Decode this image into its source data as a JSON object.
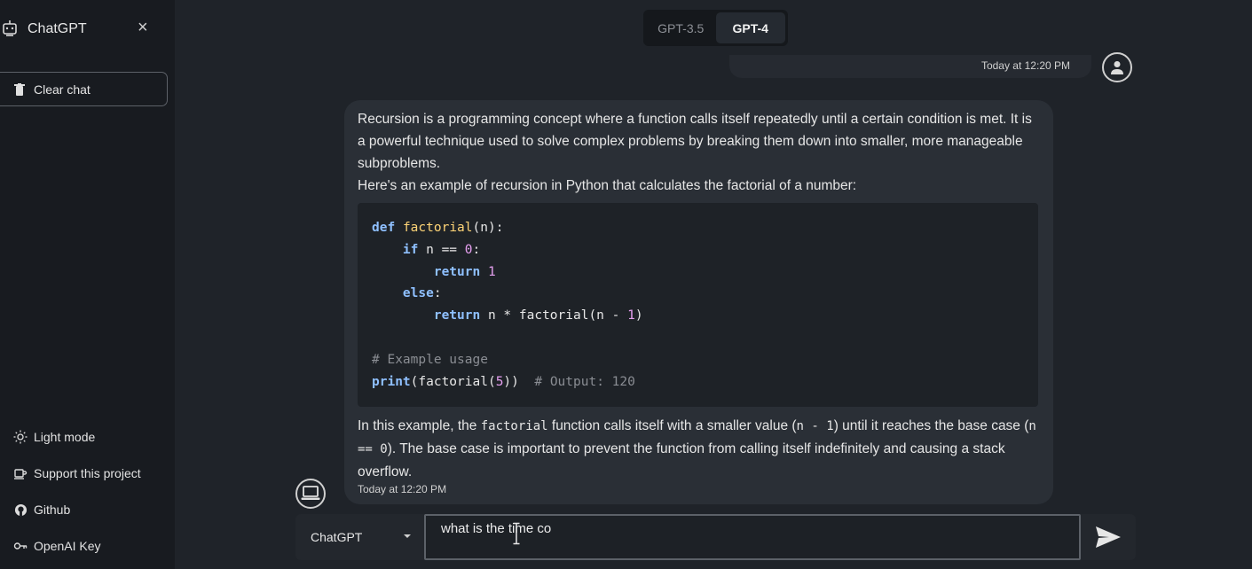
{
  "sidebar": {
    "title": "ChatGPT",
    "close_label": "×",
    "clear_label": "Clear chat",
    "items": [
      {
        "icon": "sun-icon",
        "label": "Light mode"
      },
      {
        "icon": "cup-icon",
        "label": "Support this project"
      },
      {
        "icon": "github-icon",
        "label": "Github"
      },
      {
        "icon": "key-icon",
        "label": "OpenAI Key"
      }
    ]
  },
  "model_toggle": {
    "options": [
      "GPT-3.5",
      "GPT-4"
    ],
    "selected": "GPT-4"
  },
  "user_message": {
    "timestamp": "Today at 12:20 PM"
  },
  "bot_message": {
    "intro_1": "Recursion is a programming concept where a function calls itself repeatedly until a certain condition is met. It is a powerful technique used to solve complex problems by breaking them down into smaller, more manageable subproblems.",
    "intro_2": "Here's an example of recursion in Python that calculates the factorial of a number:",
    "code": {
      "l1_kw": "def",
      "l1_fn": "factorial",
      "l1_rest": "(n):",
      "l2_kw": "if",
      "l2_rest": " n == ",
      "l2_num": "0",
      "l2_end": ":",
      "l3_kw": "return",
      "l3_num": "1",
      "l4_kw": "else",
      "l4_end": ":",
      "l5_kw": "return",
      "l5_rest": " n * factorial(n - ",
      "l5_num": "1",
      "l5_end": ")",
      "l7_comment": "# Example usage",
      "l8_kw": "print",
      "l8_rest": "(factorial(",
      "l8_num": "5",
      "l8_end": "))",
      "l8_comment": "# Output: 120"
    },
    "outro_a": "In this example, the ",
    "outro_code1": "factorial",
    "outro_b": " function calls itself with a smaller value (",
    "outro_code2": "n - 1",
    "outro_c": ") until it reaches the base case (",
    "outro_code3": "n == 0",
    "outro_d": "). The base case is important to prevent the function from calling itself indefinitely and causing a stack overflow.",
    "timestamp": "Today at 12:20 PM"
  },
  "composer": {
    "model_value": "ChatGPT",
    "input_value": "what is the time co"
  },
  "colors": {
    "background": "#1f2329",
    "sidebar": "#181b20",
    "bubble": "#2a2f36",
    "code_bg": "#1e2227"
  }
}
